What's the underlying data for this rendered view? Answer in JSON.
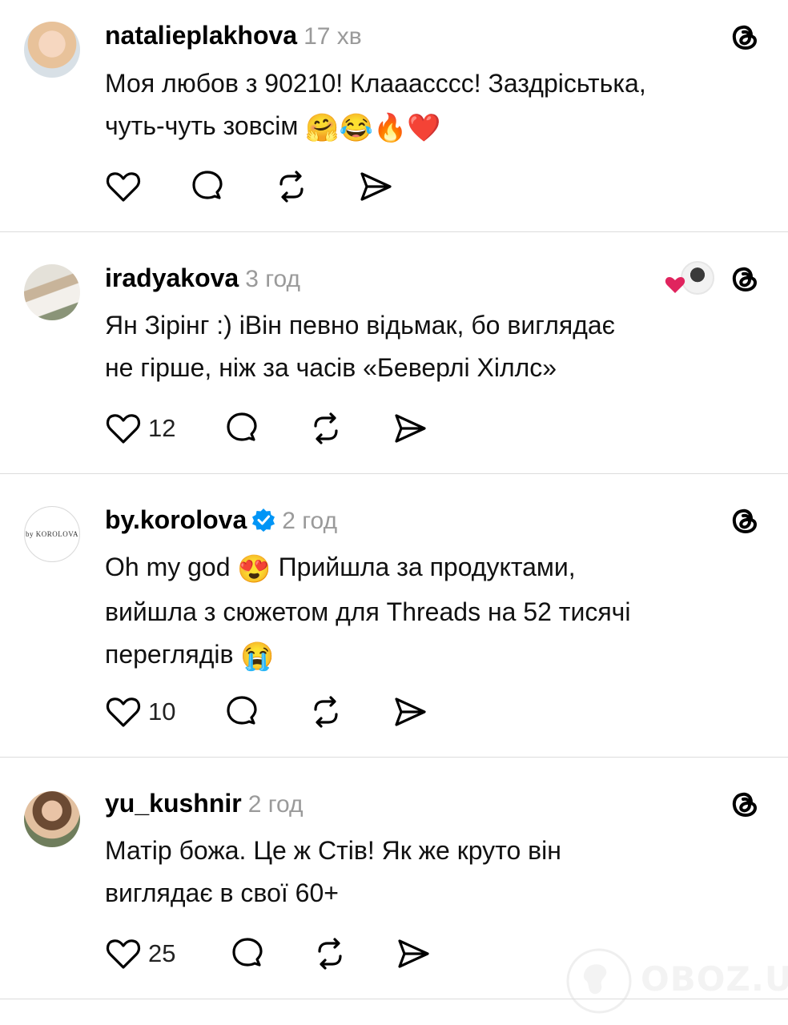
{
  "comments": [
    {
      "username": "natalieplakhova",
      "time": "17 хв",
      "text_line1": "Моя любов з 90210! Клаааcccс! Заздрісьтька,",
      "text_line2": "чуть-чуть зовсім",
      "emojis": "🤗😂🔥❤️",
      "likes": ""
    },
    {
      "username": "iradyakova",
      "time": "3 год",
      "text_line1": "Ян  Зірінг :) іВін певно відьмак, бо виглядає",
      "text_line2": "не гірше, ніж за часів «Беверлі Хіллс»",
      "likes": "12"
    },
    {
      "username": "by.korolova",
      "time": "2 год",
      "avatar_text": "by KOROLOVA",
      "text_line1a": "Oh my god",
      "emoji1": "😍",
      "text_line1b": "Прийшла за продуктами,",
      "text_line2": "вийшла з сюжетом для Threads на 52 тисячі",
      "text_line3": "переглядів",
      "emoji2": "😭",
      "likes": "10"
    },
    {
      "username": "yu_kushnir",
      "time": "2 год",
      "text_line1": "Матір божа. Це ж Стів! Як же круто він",
      "text_line2": "виглядає в свої 60+",
      "likes": "25"
    }
  ],
  "icons": {
    "like": "heart-icon",
    "reply": "speech-bubble-icon",
    "repost": "repost-icon",
    "share": "send-icon",
    "app": "threads-logo-icon",
    "verified": "verified-badge-icon"
  },
  "colors": {
    "verified": "#0095f6",
    "muted": "#9a9a9a",
    "divider": "#dcdcdc",
    "reaction_heart": "#e0245e"
  },
  "watermark": "OBOZ.UA"
}
